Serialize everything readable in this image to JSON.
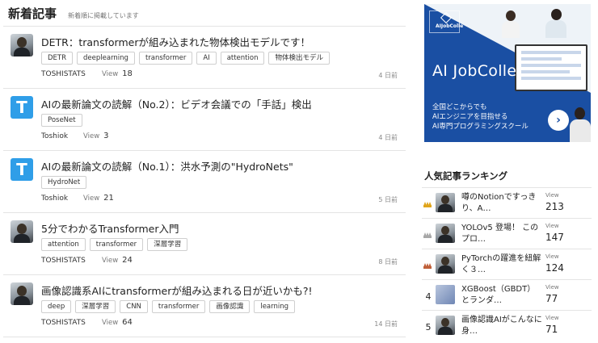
{
  "header": {
    "title": "新着記事",
    "subtitle": "新着順に掲載しています"
  },
  "articles": [
    {
      "title": "DETR：transformerが組み込まれた物体検出モデルです！",
      "tags": [
        "DETR",
        "deeplearning",
        "transformer",
        "AI",
        "attention",
        "物体検出モデル"
      ],
      "author": "TOSHISTATS",
      "view_label": "View",
      "views": "18",
      "ago": "4 日前",
      "avatar": "photo"
    },
    {
      "title": "AIの最新論文の読解（No.2）：ビデオ会議での「手話」検出",
      "tags": [
        "PoseNet"
      ],
      "author": "Toshiok",
      "view_label": "View",
      "views": "3",
      "ago": "4 日前",
      "avatar": "T"
    },
    {
      "title": "AIの最新論文の読解（No.1）：洪水予測の\"HydroNets\"",
      "tags": [
        "HydroNet"
      ],
      "author": "Toshiok",
      "view_label": "View",
      "views": "21",
      "ago": "5 日前",
      "avatar": "T"
    },
    {
      "title": "5分でわかるTransformer入門",
      "tags": [
        "attention",
        "transformer",
        "深層学習"
      ],
      "author": "TOSHISTATS",
      "view_label": "View",
      "views": "24",
      "ago": "8 日前",
      "avatar": "photo"
    },
    {
      "title": "画像認識系AIにtransformerが組み込まれる日が近いかも?!",
      "tags": [
        "deep",
        "深層学習",
        "CNN",
        "transformer",
        "画像認識",
        "learning"
      ],
      "author": "TOSHISTATS",
      "view_label": "View",
      "views": "64",
      "ago": "14 日前",
      "avatar": "photo"
    }
  ],
  "ad": {
    "logo": "AIJobColle",
    "headline": "AI JobColle",
    "copy": "全国どこからでも\nAIエンジニアを目指せる\nAI専門プログラミングスクール",
    "arrow": "›",
    "colors": {
      "brand": "#1a4fa3"
    }
  },
  "ranking": {
    "title": "人気記事ランキング",
    "items": [
      {
        "rank": "",
        "medal": "gold",
        "title": "噂のNotionですっきり、A…",
        "view_label": "View",
        "views": "213"
      },
      {
        "rank": "",
        "medal": "silver",
        "title": "YOLOv5 登場！ このプロ…",
        "view_label": "View",
        "views": "147"
      },
      {
        "rank": "",
        "medal": "bronze",
        "title": "PyTorchの躍進を紐解く３…",
        "view_label": "View",
        "views": "124"
      },
      {
        "rank": "4",
        "medal": "",
        "title": "XGBoost（GBDT）とランダ…",
        "view_label": "View",
        "views": "77"
      },
      {
        "rank": "5",
        "medal": "",
        "title": "画像認識AIがこんなに身…",
        "view_label": "View",
        "views": "71"
      }
    ],
    "medal_colors": {
      "gold": "#e0a51b",
      "silver": "#a8a8a8",
      "bronze": "#c0603a"
    }
  }
}
